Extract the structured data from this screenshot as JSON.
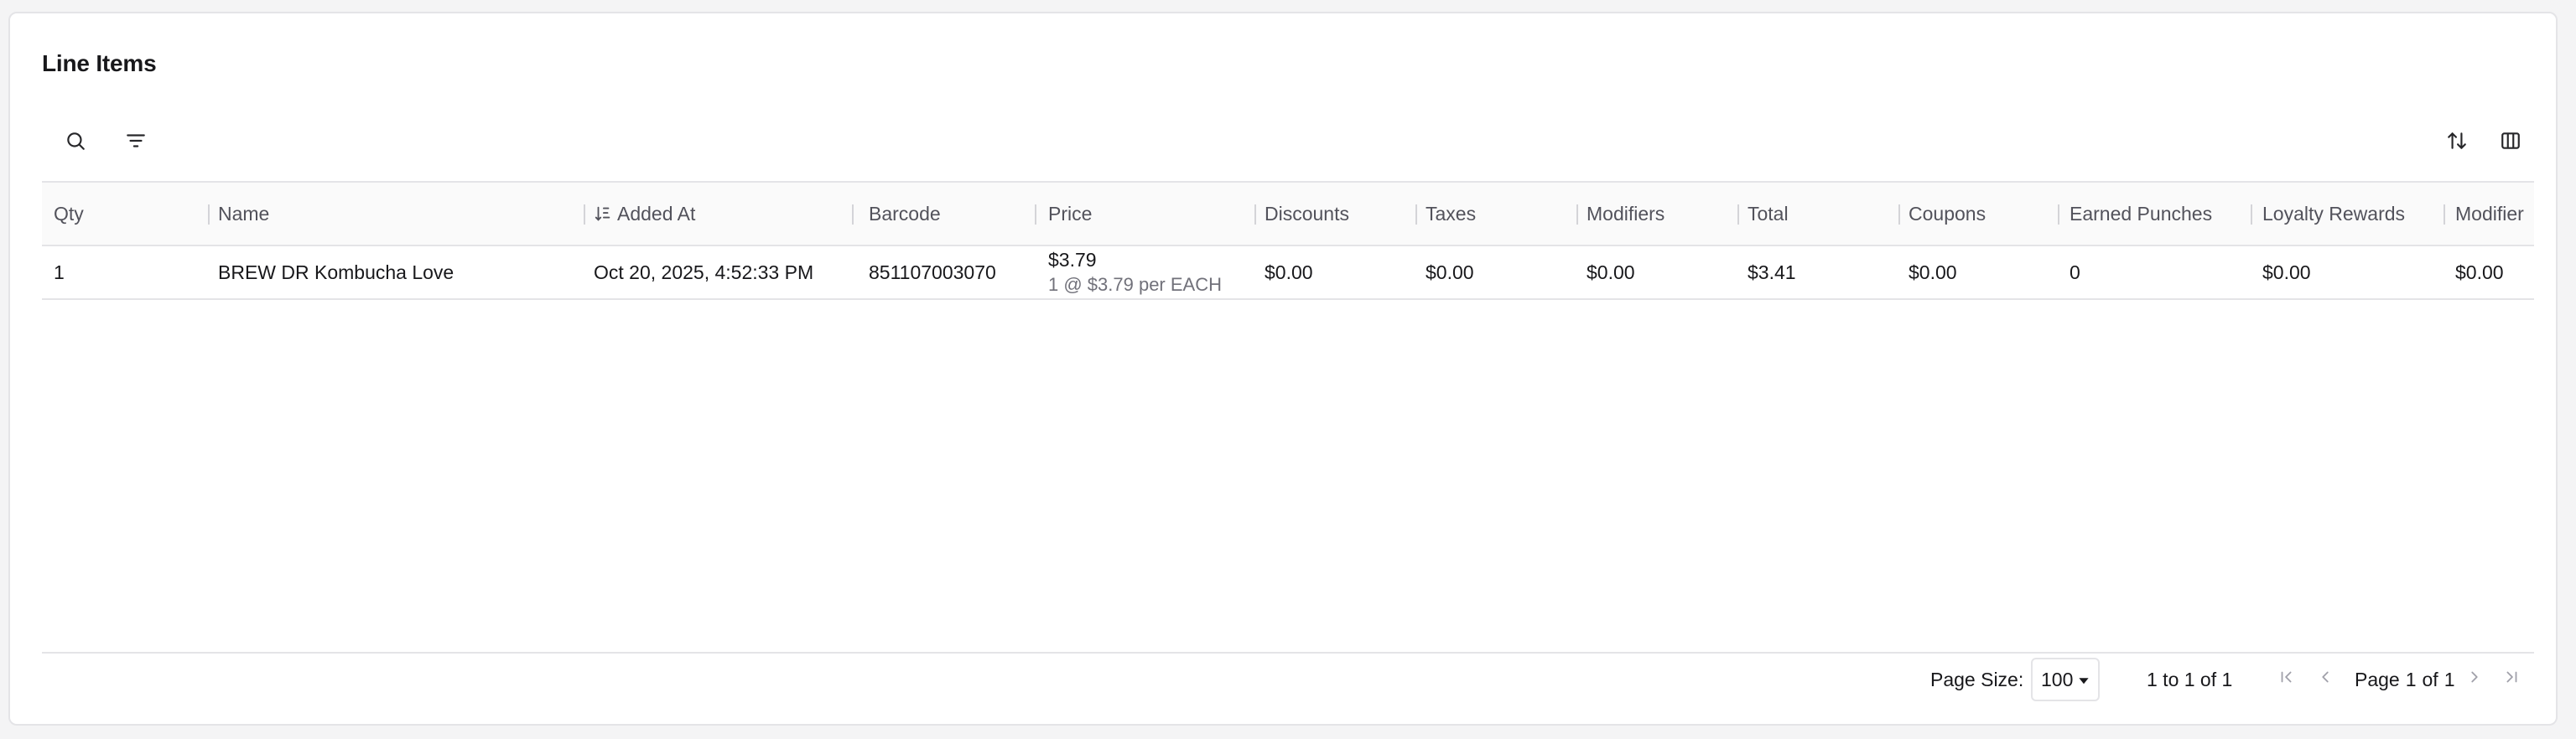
{
  "card": {
    "title": "Line Items"
  },
  "toolbar": {
    "left": [
      {
        "icon": "search-icon"
      },
      {
        "icon": "filter-icon"
      }
    ],
    "right": [
      {
        "icon": "sort-arrows-icon"
      },
      {
        "icon": "columns-icon"
      }
    ]
  },
  "table": {
    "columns": [
      "Qty",
      "Name",
      "Added At",
      "Barcode",
      "Price",
      "Discounts",
      "Taxes",
      "Modifiers",
      "Total",
      "Coupons",
      "Earned Punches",
      "Loyalty Rewards",
      "Modifier"
    ],
    "sorted_column_icon": "sort-ascending-icon",
    "rows": [
      {
        "qty": "1",
        "name": "BREW DR Kombucha Love",
        "added_at": "Oct 20, 2025, 4:52:33 PM",
        "barcode": "851107003070",
        "price": "$3.79",
        "price_detail": "1 @ $3.79 per EACH",
        "discounts": "$0.00",
        "taxes": "$0.00",
        "modifiers": "$0.00",
        "total": "$3.41",
        "coupons": "$0.00",
        "earned_punches": "0",
        "loyalty_rewards": "$0.00",
        "modifier": "$0.00"
      }
    ]
  },
  "pager": {
    "page_size_label": "Page Size:",
    "page_size_value": "100",
    "range_text": "1 to 1 of 1",
    "page_word": "Page",
    "current_page": "1",
    "of_word": "of",
    "total_pages": "1"
  },
  "colors": {
    "border": "#e4e4e7",
    "header_bg": "#fafafa",
    "muted_text": "#71717a",
    "disabled_icon": "#a1a1aa"
  }
}
